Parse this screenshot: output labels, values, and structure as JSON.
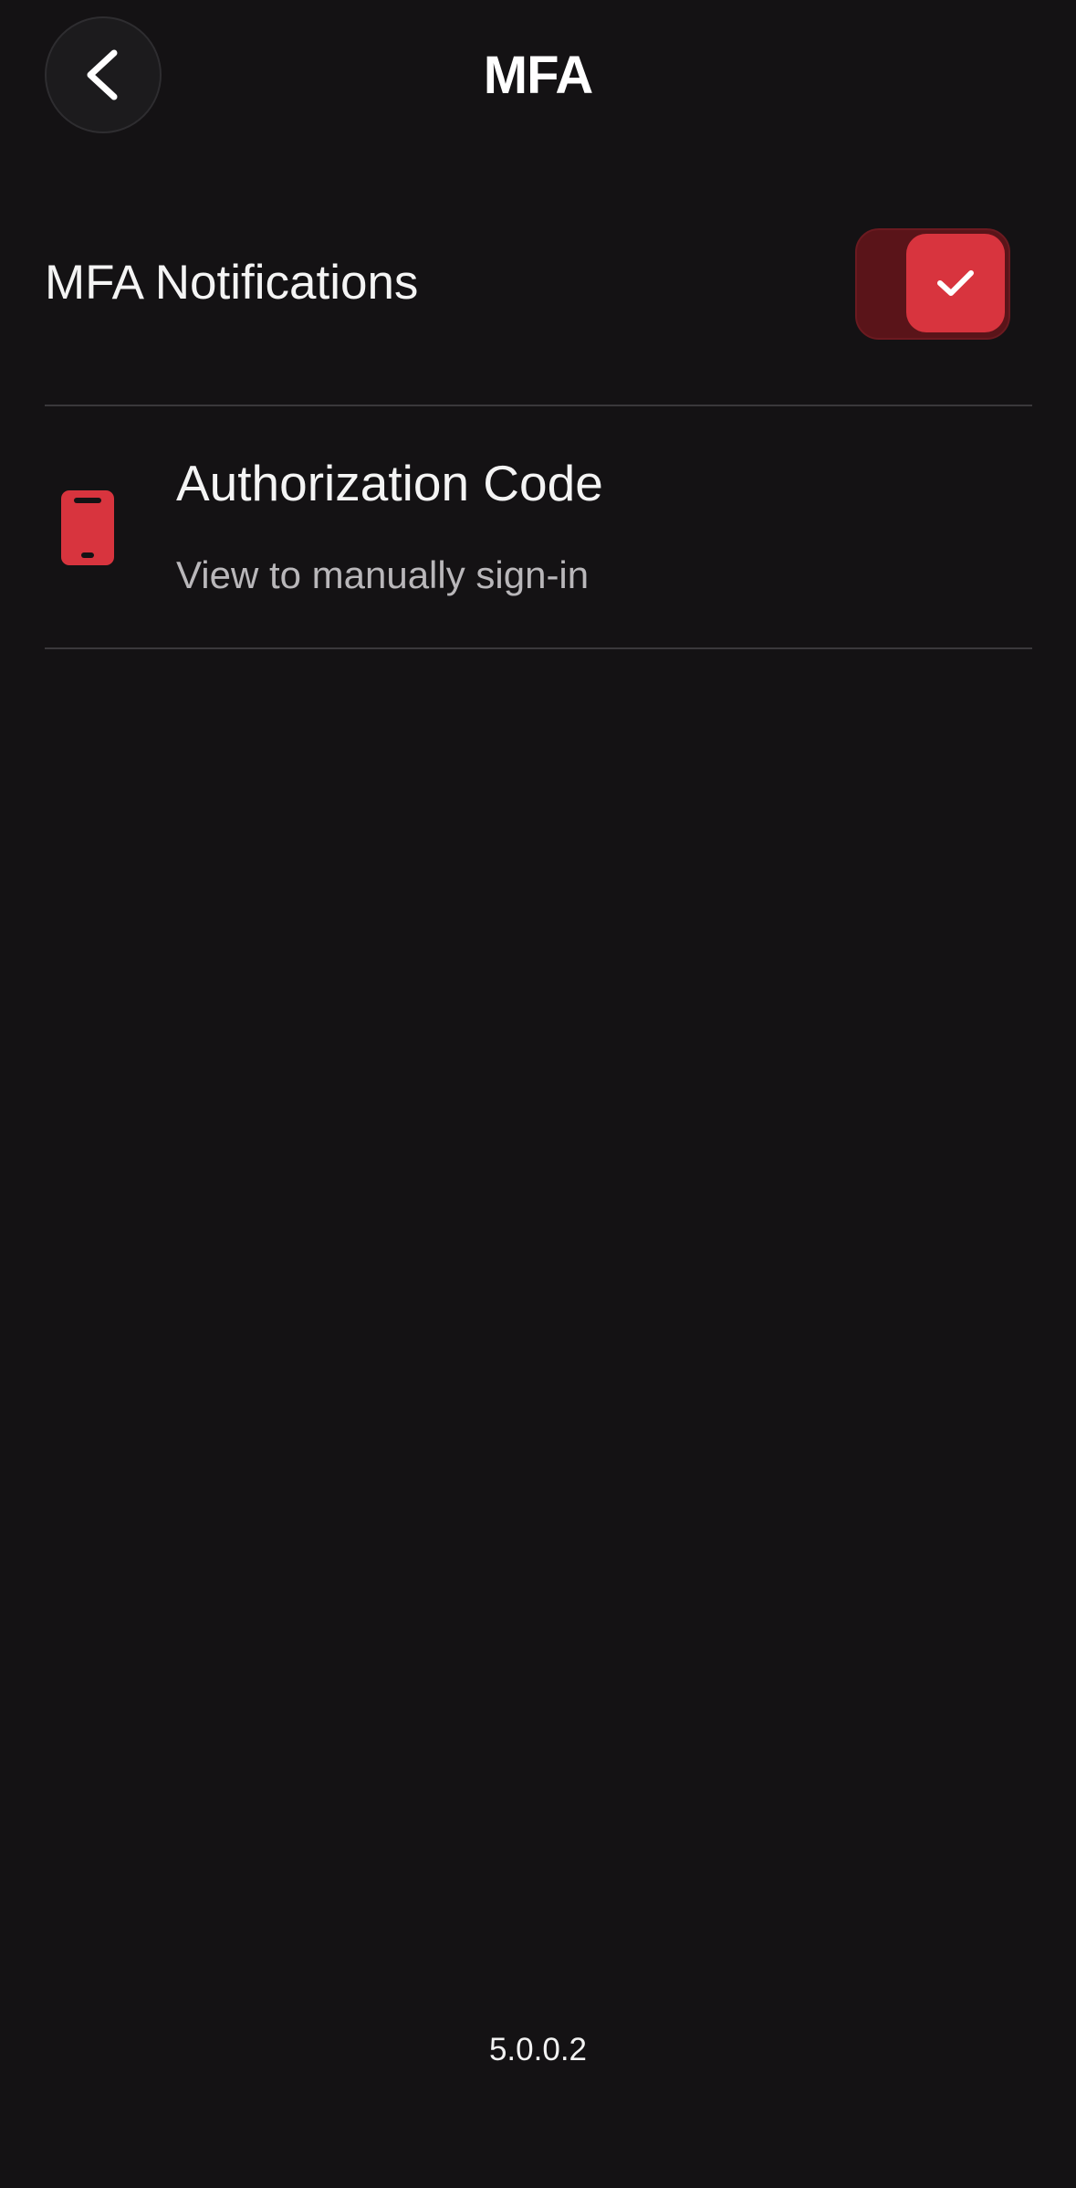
{
  "header": {
    "title": "MFA",
    "back_icon": "chevron-left-icon"
  },
  "mfa_notifications": {
    "label": "MFA Notifications",
    "enabled": true,
    "toggle_icon": "check-icon"
  },
  "authorization_code": {
    "icon": "mobile-phone-icon",
    "title": "Authorization Code",
    "subtitle": "View to manually sign-in"
  },
  "footer": {
    "version": "5.0.0.2"
  },
  "colors": {
    "background": "#141214",
    "accent": "#d8343e",
    "toggle_track": "#5a1419",
    "divider": "#3a383b",
    "secondary_text": "#b9b7ba"
  }
}
